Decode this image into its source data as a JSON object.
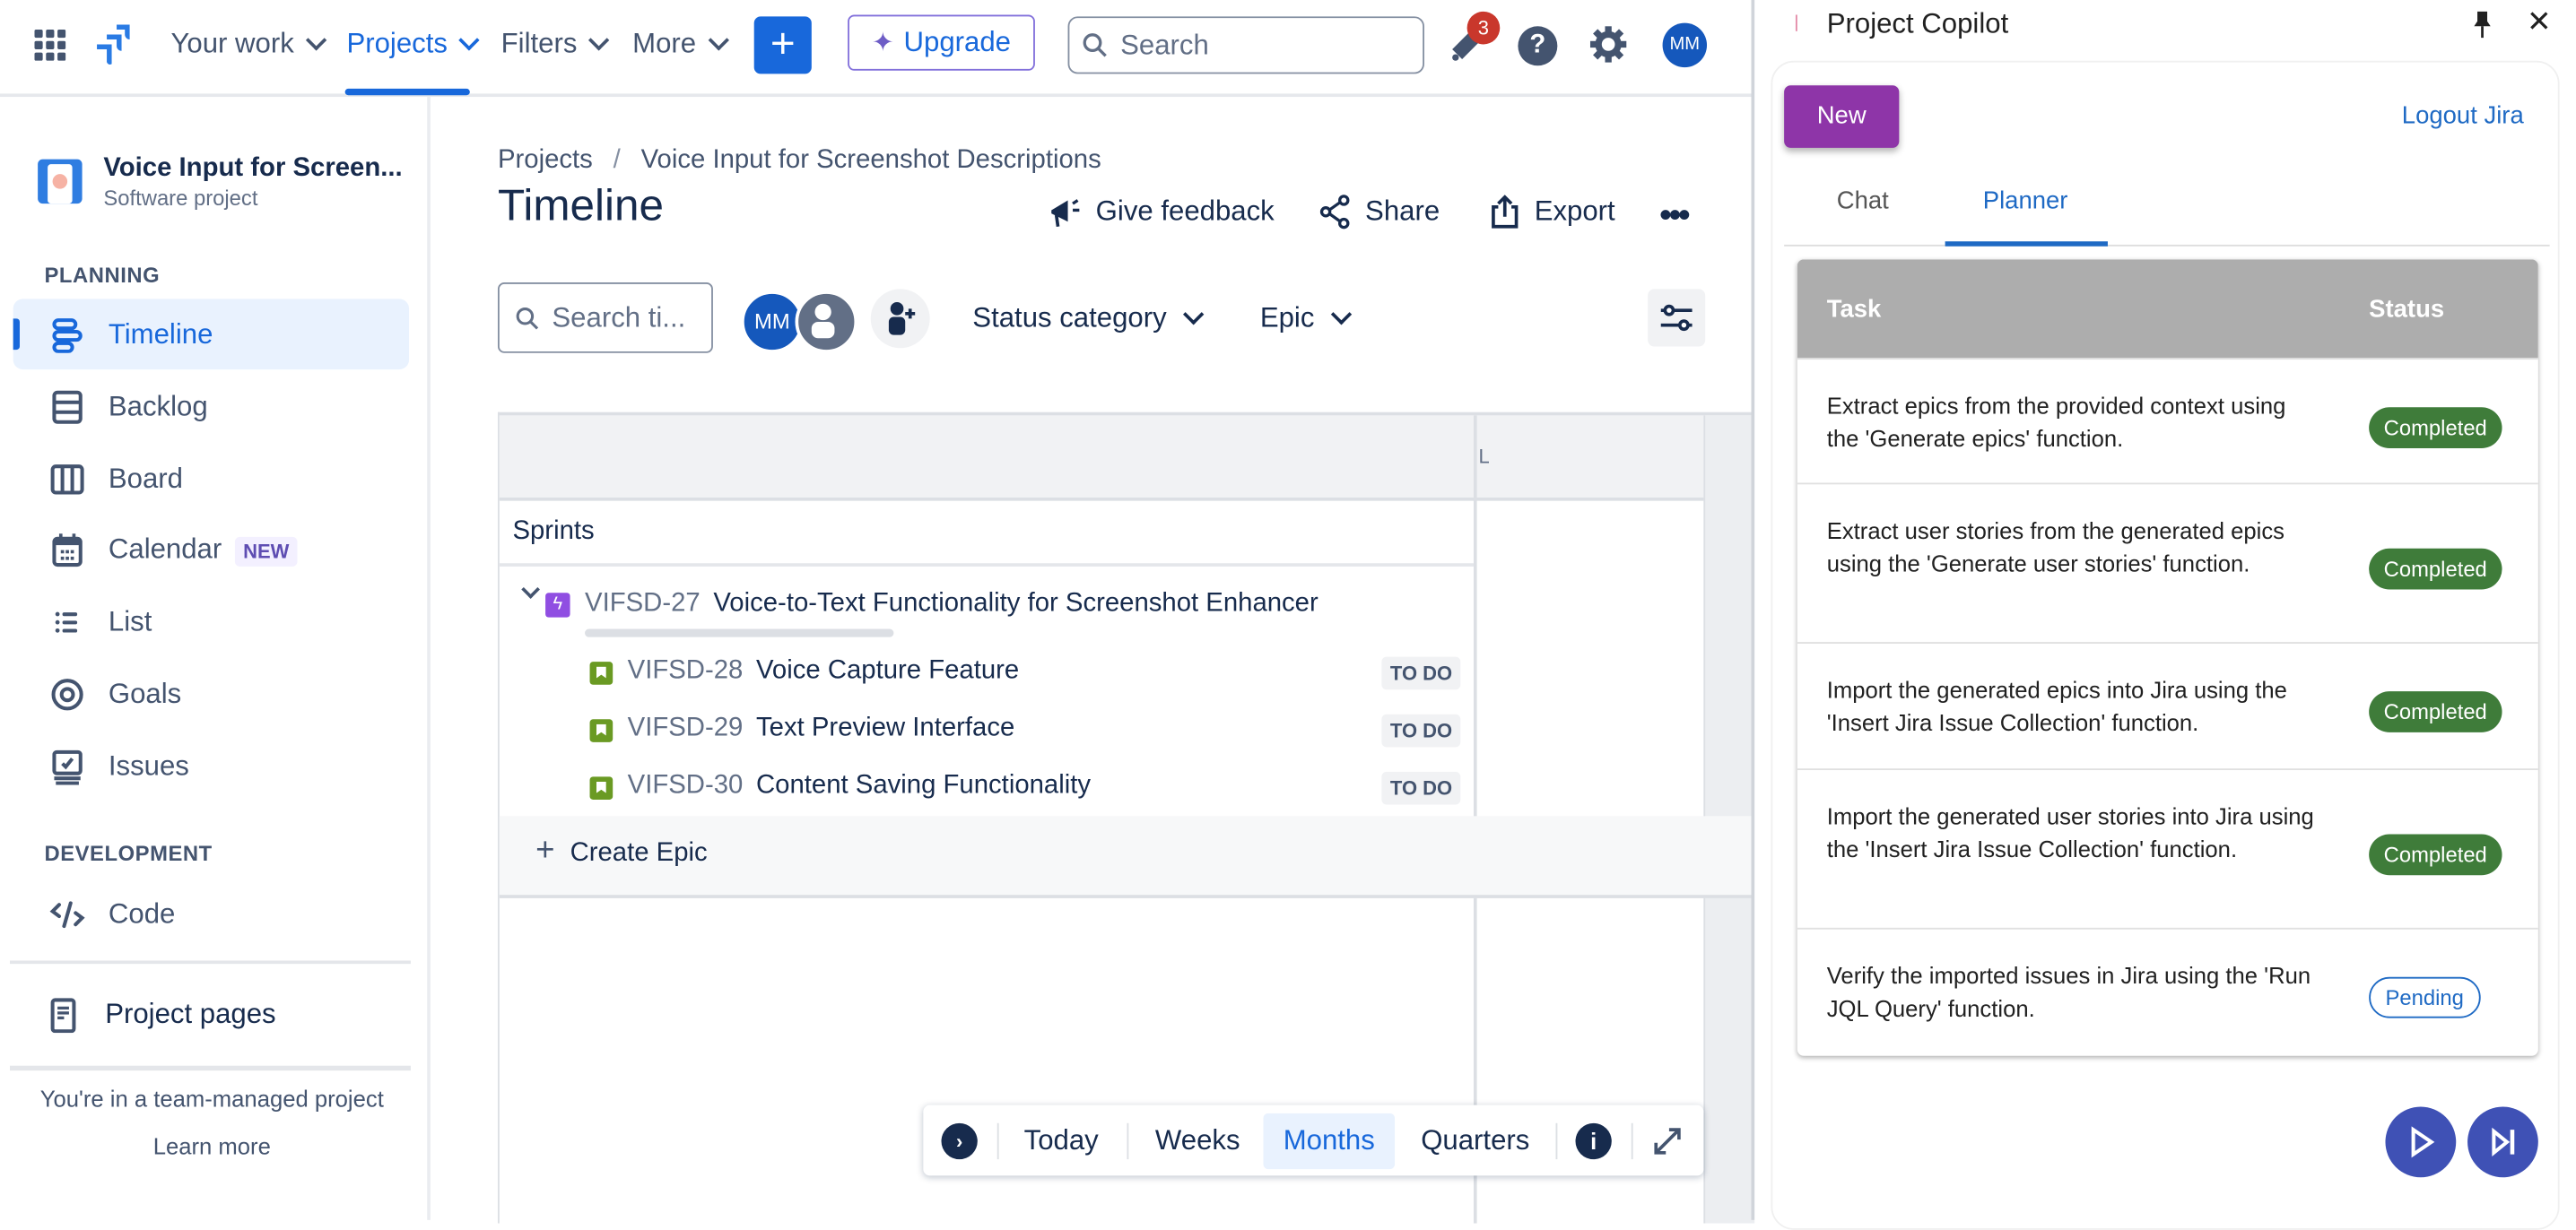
{
  "topnav": {
    "your_work": "Your work",
    "projects": "Projects",
    "filters": "Filters",
    "more": "More",
    "create_label": "+",
    "upgrade": "Upgrade",
    "search_placeholder": "Search",
    "notifications_count": "3",
    "avatar_initials": "MM"
  },
  "sidebar": {
    "project_name": "Voice Input for Screen...",
    "project_type": "Software project",
    "planning_header": "PLANNING",
    "planning_items": [
      {
        "label": "Timeline",
        "icon": "timeline-icon",
        "active": true
      },
      {
        "label": "Backlog",
        "icon": "backlog-icon"
      },
      {
        "label": "Board",
        "icon": "board-icon"
      },
      {
        "label": "Calendar",
        "icon": "calendar-icon",
        "badge": "NEW"
      },
      {
        "label": "List",
        "icon": "list-icon"
      },
      {
        "label": "Goals",
        "icon": "goals-icon"
      },
      {
        "label": "Issues",
        "icon": "issues-icon"
      }
    ],
    "development_header": "DEVELOPMENT",
    "code_label": "Code",
    "project_pages": "Project pages",
    "team_managed": "You're in a team-managed project",
    "learn_more": "Learn more"
  },
  "main": {
    "breadcrumb": {
      "root": "Projects",
      "separator": "/",
      "project": "Voice Input for Screenshot Descriptions"
    },
    "title": "Timeline",
    "actions": {
      "feedback": "Give feedback",
      "share": "Share",
      "export": "Export"
    },
    "search_placeholder": "Search ti...",
    "avatar_initials": "MM",
    "filters": {
      "status_category": "Status category",
      "epic": "Epic"
    },
    "grid": {
      "column_marker": "L",
      "sprints_label": "Sprints",
      "epic": {
        "key": "VIFSD-27",
        "summary": "Voice-to-Text Functionality for Screenshot Enhancer"
      },
      "stories": [
        {
          "key": "VIFSD-28",
          "summary": "Voice Capture Feature",
          "status": "TO DO"
        },
        {
          "key": "VIFSD-29",
          "summary": "Text Preview Interface",
          "status": "TO DO"
        },
        {
          "key": "VIFSD-30",
          "summary": "Content Saving Functionality",
          "status": "TO DO"
        }
      ],
      "create_epic": "Create Epic"
    },
    "bottom_bar": {
      "today": "Today",
      "weeks": "Weeks",
      "months": "Months",
      "quarters": "Quarters",
      "selected": "Months"
    }
  },
  "copilot": {
    "title": "Project Copilot",
    "new_button": "New",
    "logout": "Logout Jira",
    "tabs": [
      {
        "label": "Chat"
      },
      {
        "label": "Planner",
        "active": true
      }
    ],
    "table": {
      "headers": {
        "task": "Task",
        "status": "Status"
      },
      "rows": [
        {
          "task": "Extract epics from the provided context using the 'Generate epics' function.",
          "status": "Completed"
        },
        {
          "task": "Extract user stories from the generated epics using the 'Generate user stories' function.",
          "status": "Completed"
        },
        {
          "task": "Import the generated epics into Jira using the 'Insert Jira Issue Collection' function.",
          "status": "Completed"
        },
        {
          "task": "Import the generated user stories into Jira using the 'Insert Jira Issue Collection' function.",
          "status": "Completed"
        },
        {
          "task": "Verify the imported issues in Jira using the 'Run JQL Query' function.",
          "status": "Pending"
        }
      ]
    },
    "colors": {
      "new_button": "#8e35a8",
      "completed": "#3f7c3a",
      "pending": "#1f6ac4",
      "fab": "#3f51b5"
    }
  },
  "colors": {
    "brand_blue": "#1868db",
    "text": "#172b4d",
    "subtle": "#44546f"
  }
}
